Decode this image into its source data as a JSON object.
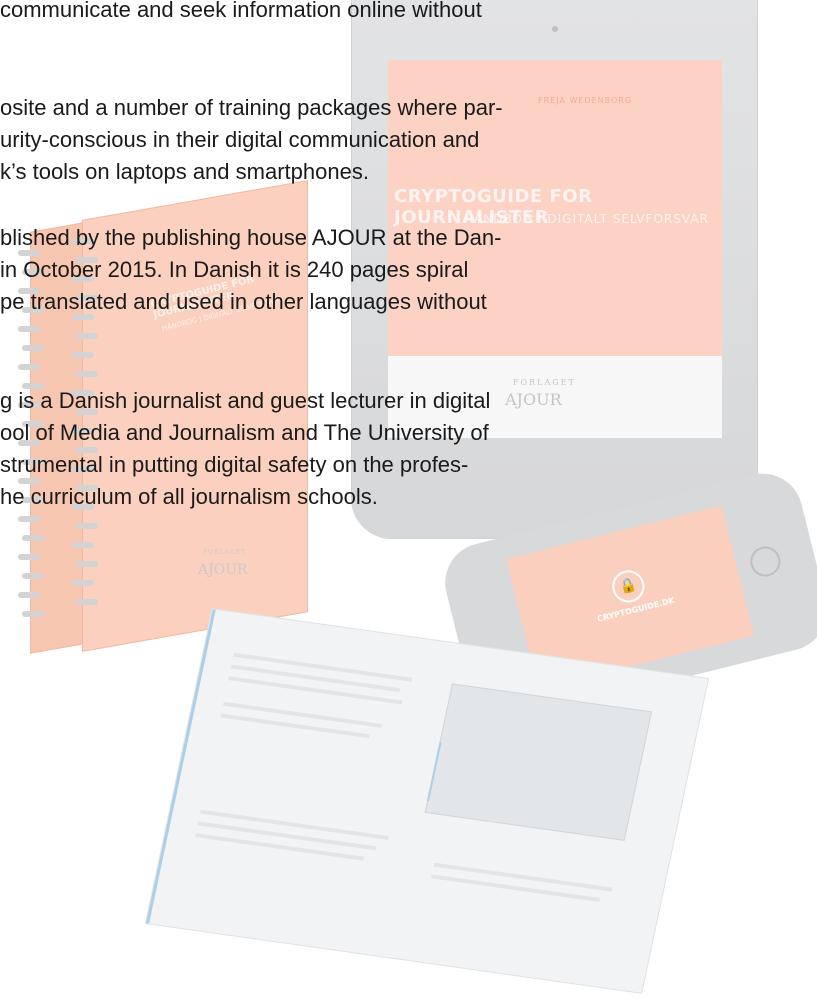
{
  "paragraphs": [
    {
      "lines": [
        "communicate and seek information online without"
      ]
    },
    {
      "lines": [
        "osite and a number of training packages where par-",
        "urity-conscious in their digital communication and",
        "k’s tools on laptops and smartphones."
      ]
    },
    {
      "lines": [
        "blished by the publishing house AJOUR at the Dan-",
        "in October 2015. In Danish it is 240 pages spiral",
        "pe translated and used in other languages without"
      ]
    },
    {
      "lines": [
        "g is a Danish journalist and guest lecturer in digital",
        "ool of Media and Journalism and The University of",
        "strumental in putting digital safety on the profes-",
        "he curriculum of all journalism schools."
      ]
    }
  ],
  "tablet": {
    "author": "FREJA WEDENBORG",
    "title": "CRYPTOGUIDE FOR JOURNALISTER",
    "subtitle": "HÅNDBOG I DIGITALT SELVFORSVAR",
    "publisher_small": "FORLAGET",
    "publisher": "AJOUR"
  },
  "book": {
    "title": "CRYPTOGUIDE FOR JOURNALISTER",
    "subtitle": "HÅNDBOG I DIGITALT SELVFORSVAR",
    "publisher_small": "FORLAGET",
    "publisher": "AJOUR"
  },
  "phone": {
    "label": "CRYPTOGUIDE.DK"
  },
  "colors": {
    "accent": "#f15a24",
    "text": "#1a1a1a"
  }
}
